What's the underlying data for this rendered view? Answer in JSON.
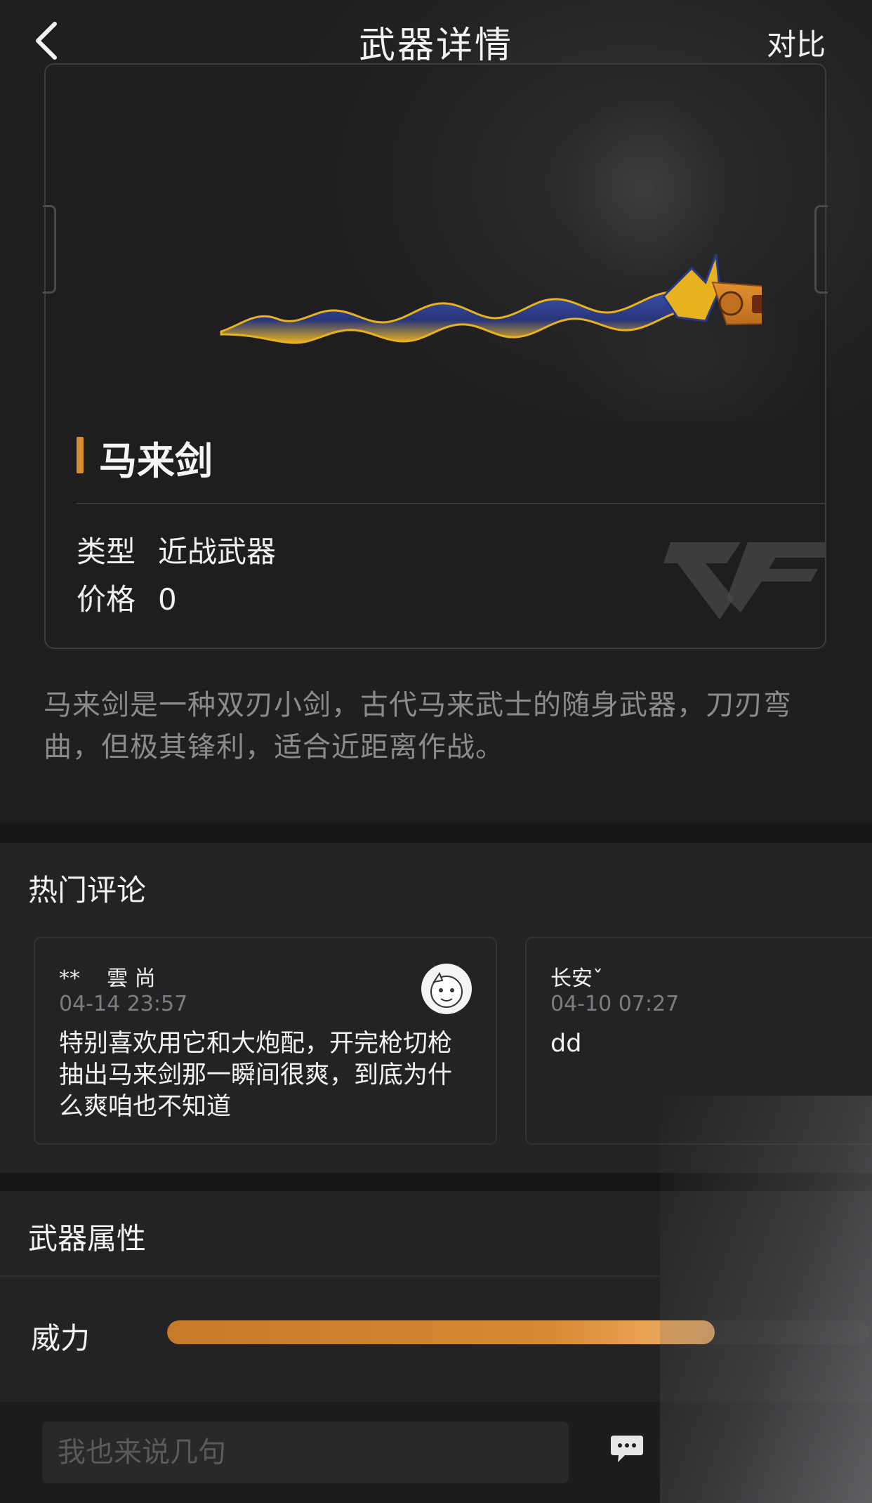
{
  "header": {
    "title": "武器详情",
    "compare_label": "对比",
    "back_icon": "chevron-left-icon"
  },
  "weapon": {
    "name": "马来剑",
    "type_label": "类型",
    "type_value": "近战武器",
    "price_label": "价格",
    "price_value": "0",
    "description": "马来剑是一种双刃小剑，古代马来武士的随身武器，刀刃弯曲，但极其锋利，适合近距离作战。"
  },
  "comments": {
    "title": "热门评论",
    "items": [
      {
        "user": "**    雲 尚",
        "time": "04-14 23:57",
        "text": "特别喜欢用它和大炮配，开完枪切枪抽出马来剑那一瞬间很爽，到底为什么爽咱也不知道"
      },
      {
        "user": "长安ˇ",
        "time": "04-10 07:27",
        "text": "dd"
      }
    ]
  },
  "attributes": {
    "title": "武器属性",
    "power_label": "威力",
    "power_level": 0.78
  },
  "footer": {
    "input_placeholder": "我也来说几句",
    "send_icon": "chat-bubble-icon"
  },
  "colors": {
    "accent": "#d9892e",
    "background": "#1b1b1d",
    "muted_text": "#8b8b8d"
  }
}
